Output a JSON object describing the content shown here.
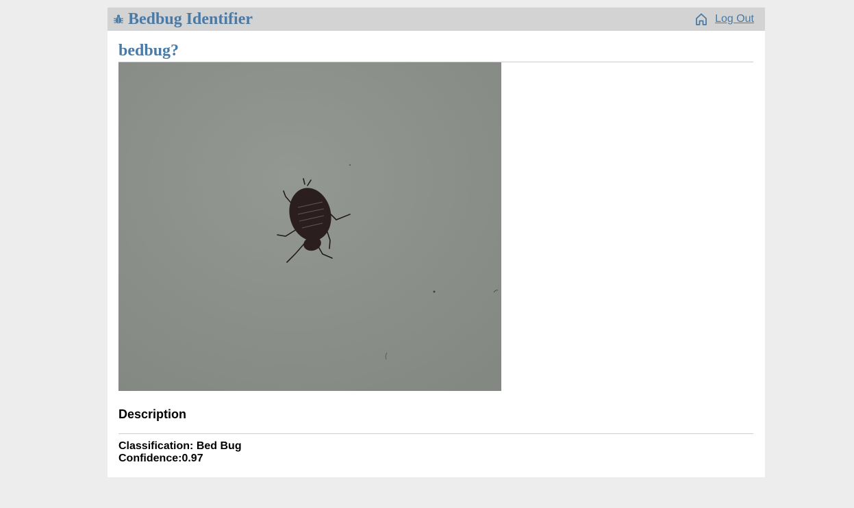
{
  "header": {
    "app_title": "Bedbug Identifier",
    "logout_label": "Log Out",
    "brand_icon": "bug-icon",
    "home_icon": "home-icon"
  },
  "main": {
    "page_title": "bedbug?",
    "image_subject": "bed bug on a gray wall",
    "description_heading": "Description",
    "classification_label": "Classification:",
    "classification_value": "Bed Bug",
    "confidence_label": "Confidence:",
    "confidence_value": "0.97"
  },
  "colors": {
    "accent": "#4a7aa5",
    "header_bg": "#d3d3d3",
    "page_bg": "#ededed"
  }
}
